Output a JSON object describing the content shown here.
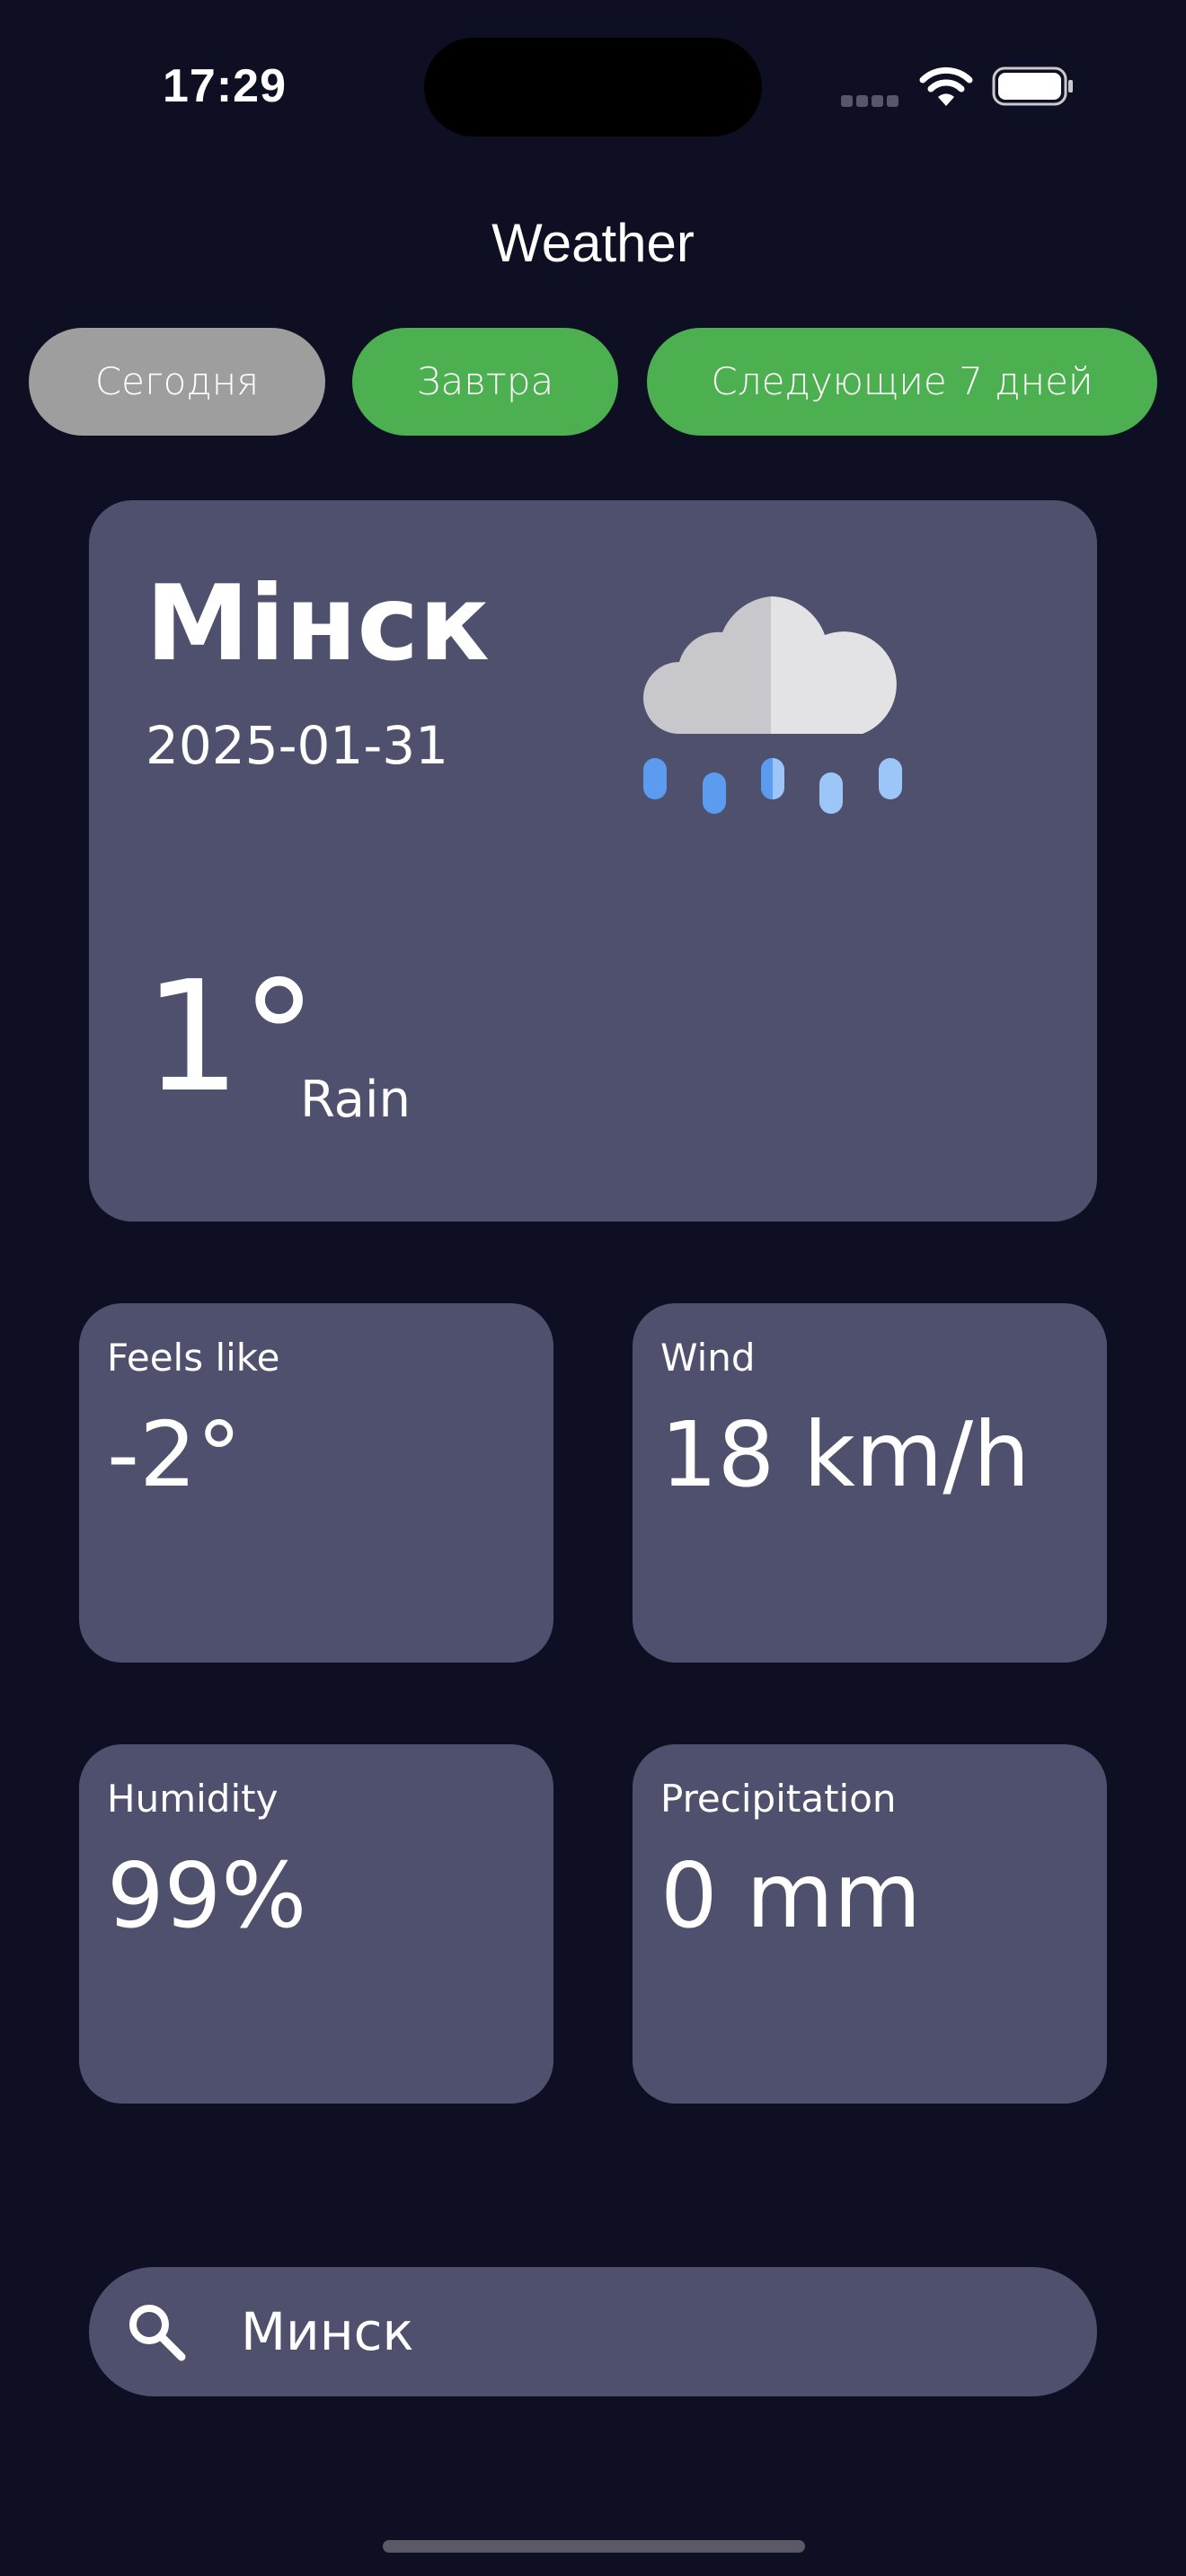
{
  "status_bar": {
    "time": "17:29"
  },
  "header": {
    "title": "Weather"
  },
  "tabs": [
    {
      "label": "Сегодня",
      "color": "#9e9e9e"
    },
    {
      "label": "Завтра",
      "color": "#4caf50"
    },
    {
      "label": "Следующие 7 дней",
      "color": "#4caf50"
    }
  ],
  "current": {
    "city": "Мінск",
    "date": "2025-01-31",
    "temperature": "1°",
    "condition": "Rain",
    "icon": "rain-cloud-icon"
  },
  "stats": [
    {
      "label": "Feels like",
      "value": "-2°"
    },
    {
      "label": "Wind",
      "value": "18 km/h"
    },
    {
      "label": "Humidity",
      "value": "99%"
    },
    {
      "label": "Precipitation",
      "value": "0 mm"
    }
  ],
  "search": {
    "value": "Минск",
    "icon": "search-icon"
  },
  "colors": {
    "background": "#0f0f23",
    "card": "#4f506d",
    "accent_green": "#4caf50",
    "inactive_gray": "#9e9e9e"
  }
}
